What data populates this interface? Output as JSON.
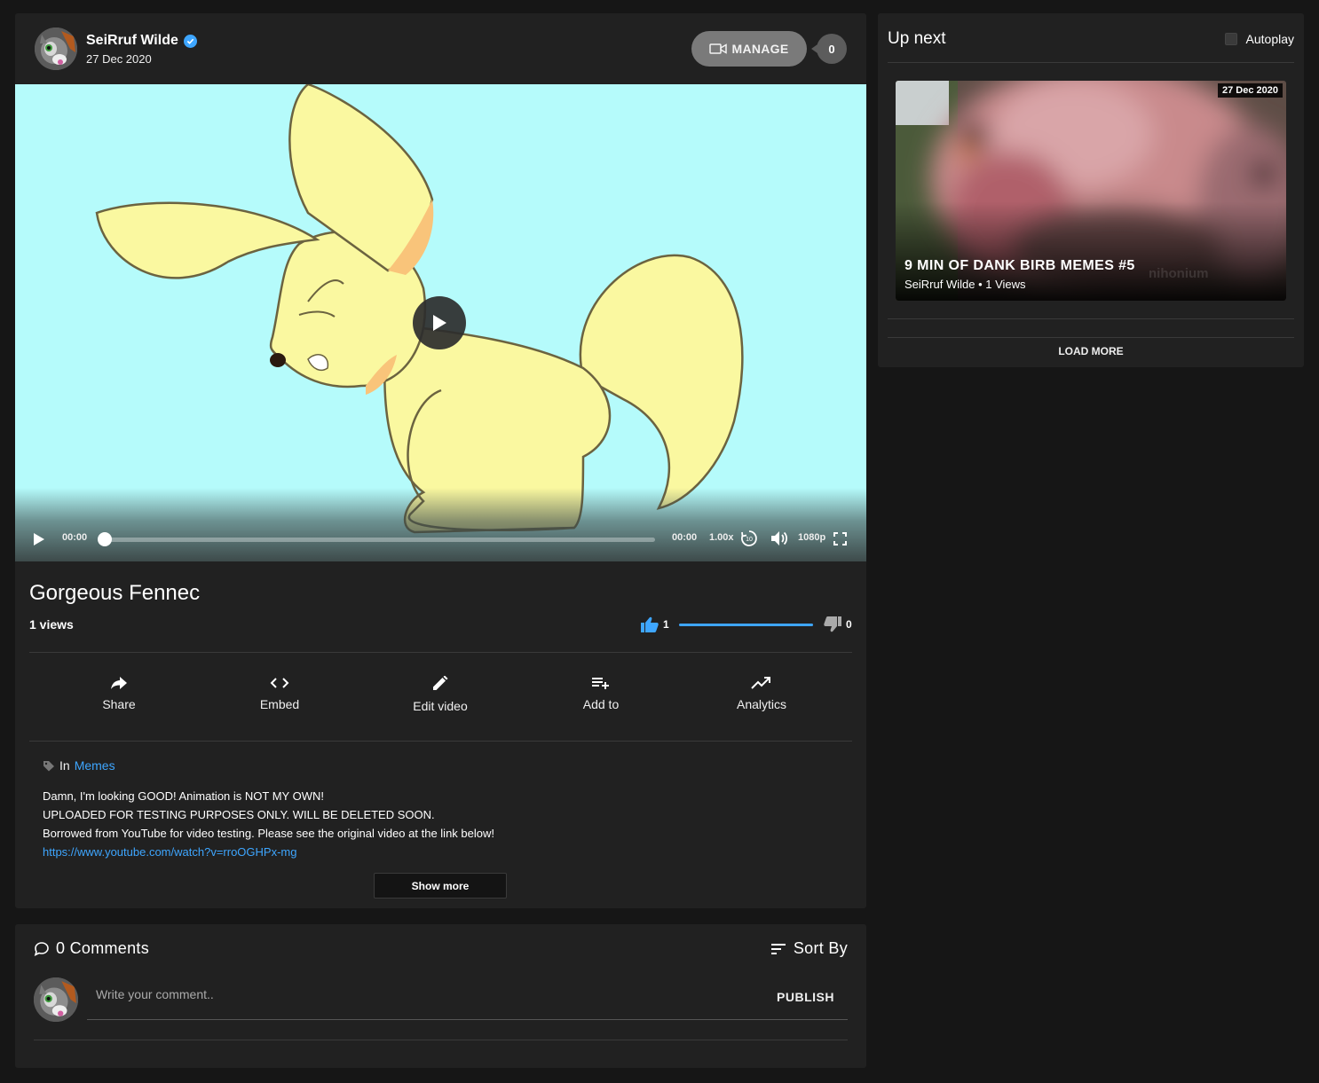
{
  "channel": {
    "name": "SeiRruf Wilde",
    "date": "27 Dec 2020",
    "manage_label": "MANAGE",
    "subscriber_count": "0"
  },
  "player": {
    "current_time": "00:00",
    "duration": "00:00",
    "speed": "1.00x",
    "quality": "1080p",
    "rewind_seconds": "10",
    "progress": 0
  },
  "video": {
    "title": "Gorgeous Fennec",
    "views": "1 views",
    "likes": "1",
    "dislikes": "0",
    "like_ratio": 1.0
  },
  "actions": [
    {
      "label": "Share",
      "icon": "share-icon"
    },
    {
      "label": "Embed",
      "icon": "code-icon"
    },
    {
      "label": "Edit video",
      "icon": "pencil-icon"
    },
    {
      "label": "Add to",
      "icon": "playlist-add-icon"
    },
    {
      "label": "Analytics",
      "icon": "trending-up-icon"
    }
  ],
  "description": {
    "category_prefix": "In",
    "category": "Memes",
    "lines": [
      "Damn, I'm looking GOOD! Animation is NOT MY OWN!",
      "UPLOADED FOR TESTING PURPOSES ONLY. WILL BE DELETED SOON.",
      "Borrowed from YouTube for video testing. Please see the original video at the link below!"
    ],
    "link": "https://www.youtube.com/watch?v=rroOGHPx-mg",
    "show_more": "Show more"
  },
  "comments": {
    "count_label": "0 Comments",
    "sort_label": "Sort By",
    "placeholder": "Write your comment..",
    "publish_label": "PUBLISH"
  },
  "sidebar": {
    "title": "Up next",
    "autoplay_label": "Autoplay",
    "autoplay_on": false,
    "items": [
      {
        "title": "9 MIN OF DANK BIRB MEMES #5",
        "meta": "SeiRruf Wilde • 1 Views",
        "date": "27 Dec 2020",
        "watermark": "nihonium"
      }
    ],
    "load_more": "LOAD MORE"
  },
  "colors": {
    "background": "#161616",
    "card": "#212121",
    "accent": "#3ea6ff",
    "player_bg": "#b5fbfb",
    "fennec": "#faf8a0"
  }
}
